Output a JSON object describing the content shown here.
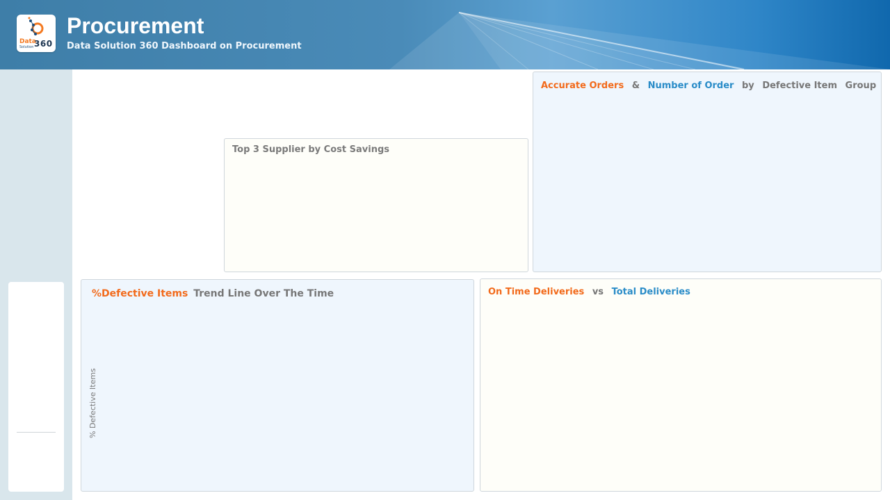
{
  "header": {
    "title": "Procurement",
    "subtitle": "Data Solution 360 Dashboard on Procurement",
    "logo": {
      "word1": "Data",
      "word2": "Solution",
      "number": "360"
    }
  },
  "colors": {
    "accent_orange": "#f26a1b",
    "accent_blue": "#2a8cc8",
    "header_blue": "#3e7ea8"
  },
  "cards": {
    "top3_supplier": {
      "title": "Top 3 Supplier by Cost Savings"
    },
    "accurate_orders": {
      "title_part1": "Accurate Orders",
      "title_amp": "&",
      "title_part2": "Number of Order",
      "title_by": "by",
      "title_part3": "Defective Item",
      "title_part4": "Group"
    },
    "defective_trend": {
      "title_part1": "%Defective Items",
      "title_part2": "Trend Line Over The Time",
      "y_axis_label": "% Defective Items"
    },
    "ontime_deliveries": {
      "title_part1": "On Time Deliveries",
      "title_vs": "vs",
      "title_part2": "Total Deliveries"
    }
  }
}
